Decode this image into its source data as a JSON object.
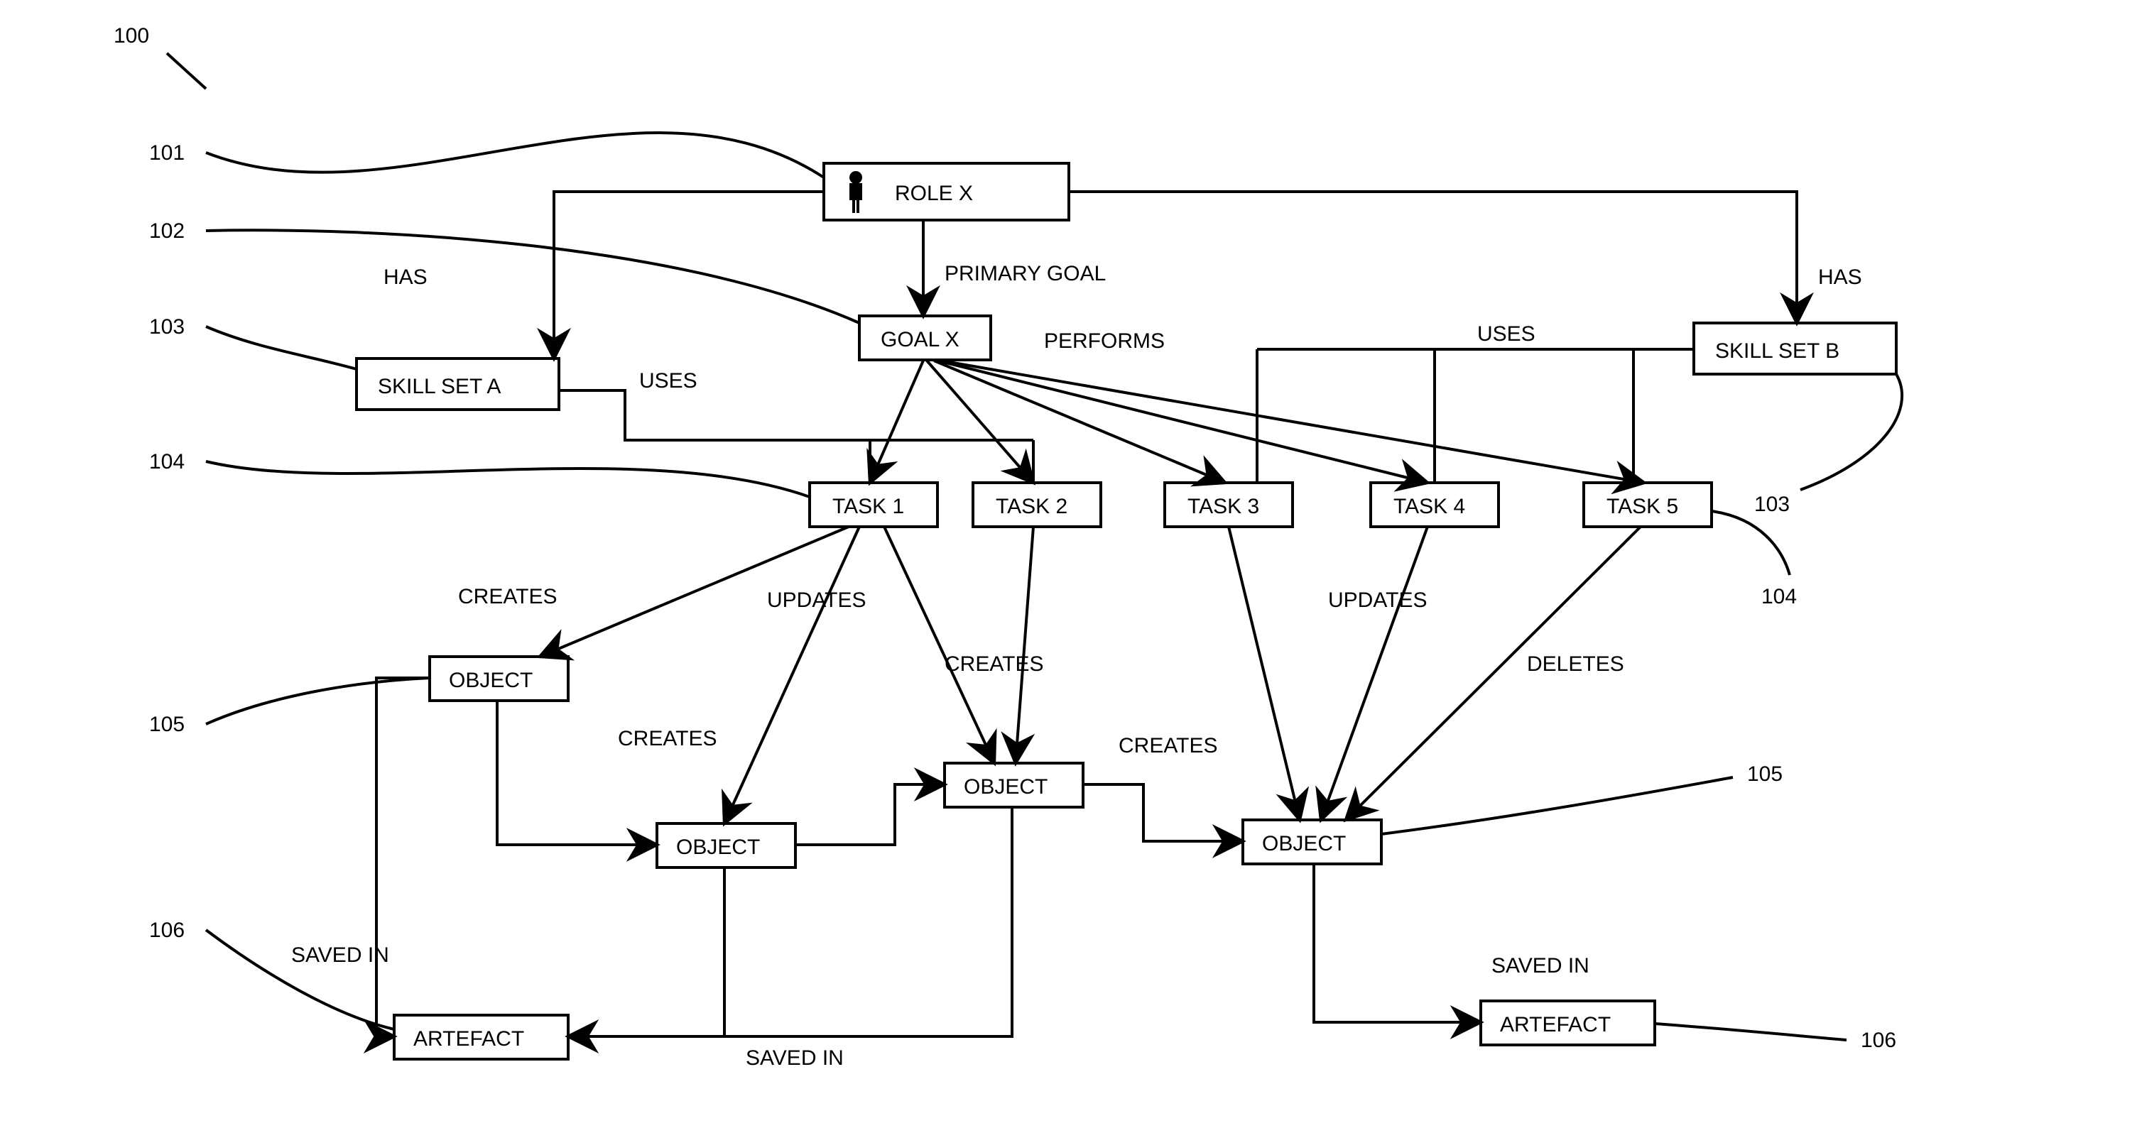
{
  "refs": {
    "r100": "100",
    "r101": "101",
    "r102": "102",
    "r103a": "103",
    "r103b": "103",
    "r104a": "104",
    "r104b": "104",
    "r105a": "105",
    "r105b": "105",
    "r106a": "106",
    "r106b": "106"
  },
  "nodes": {
    "role": "ROLE X",
    "goal": "GOAL X",
    "skillA": "SKILL SET A",
    "skillB": "SKILL SET B",
    "task1": "TASK 1",
    "task2": "TASK 2",
    "task3": "TASK 3",
    "task4": "TASK 4",
    "task5": "TASK 5",
    "obj1": "OBJECT",
    "obj2": "OBJECT",
    "obj3": "OBJECT",
    "obj4": "OBJECT",
    "art1": "ARTEFACT",
    "art2": "ARTEFACT"
  },
  "edges": {
    "has1": "HAS",
    "has2": "HAS",
    "primaryGoal": "PRIMARY GOAL",
    "performs": "PERFORMS",
    "uses1": "USES",
    "uses2": "USES",
    "creates1": "CREATES",
    "creates2": "CREATES",
    "creates3": "CREATES",
    "creates4": "CREATES",
    "updates1": "UPDATES",
    "updates2": "UPDATES",
    "deletes": "DELETES",
    "savedIn1": "SAVED IN",
    "savedIn2": "SAVED IN",
    "savedIn3": "SAVED IN"
  }
}
